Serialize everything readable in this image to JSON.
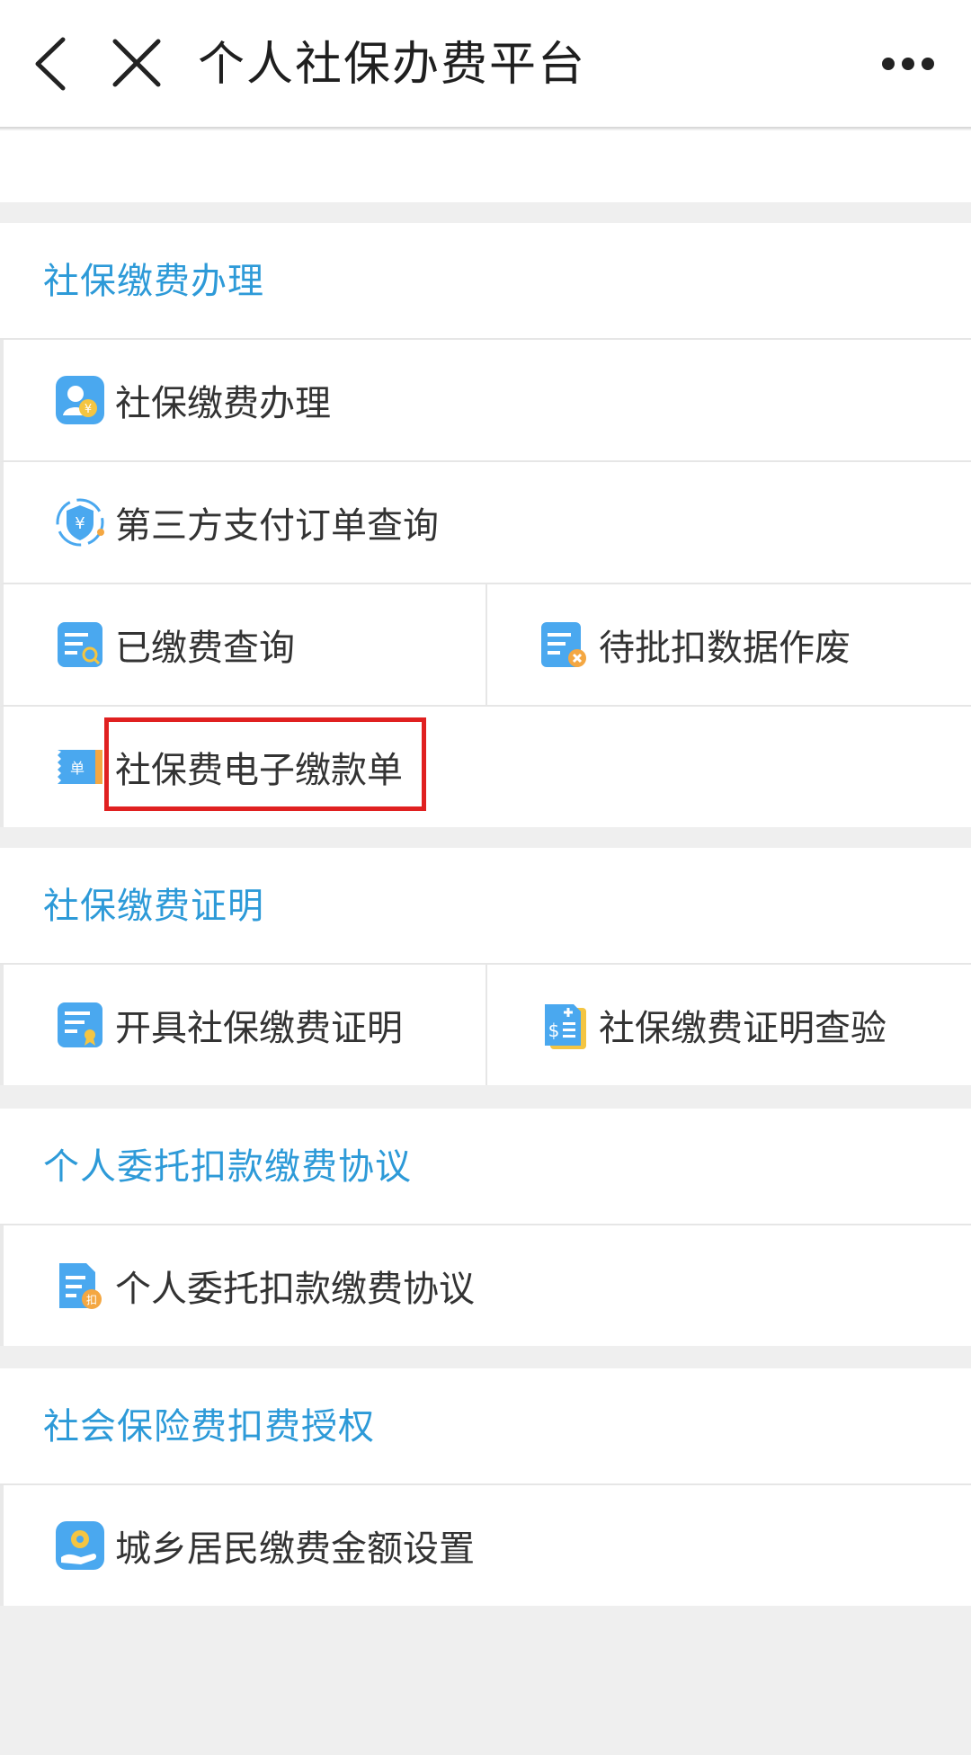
{
  "header": {
    "title": "个人社保办费平台",
    "back_icon": "chevron-left-icon",
    "close_icon": "close-icon",
    "more_icon": "more-dots-icon"
  },
  "sections": [
    {
      "title": "社保缴费办理",
      "items": [
        {
          "label": "社保缴费办理",
          "icon": "person-yuan-icon"
        },
        {
          "label": "第三方支付订单查询",
          "icon": "shield-yuan-icon"
        },
        {
          "label": "已缴费查询",
          "icon": "document-search-icon"
        },
        {
          "label": "待批扣数据作废",
          "icon": "document-cancel-icon"
        },
        {
          "label": "社保费电子缴款单",
          "icon": "receipt-icon"
        }
      ]
    },
    {
      "title": "社保缴费证明",
      "items": [
        {
          "label": "开具社保缴费证明",
          "icon": "certificate-icon"
        },
        {
          "label": "社保缴费证明查验",
          "icon": "dollar-document-icon"
        }
      ]
    },
    {
      "title": "个人委托扣款缴费协议",
      "items": [
        {
          "label": "个人委托扣款缴费协议",
          "icon": "agreement-document-icon"
        }
      ]
    },
    {
      "title": "社会保险费扣费授权",
      "items": [
        {
          "label": "城乡居民缴费金额设置",
          "icon": "gear-hand-icon"
        }
      ]
    }
  ],
  "colors": {
    "accent": "#2d9ad8",
    "highlight_border": "#e02020",
    "background": "#efefef"
  }
}
